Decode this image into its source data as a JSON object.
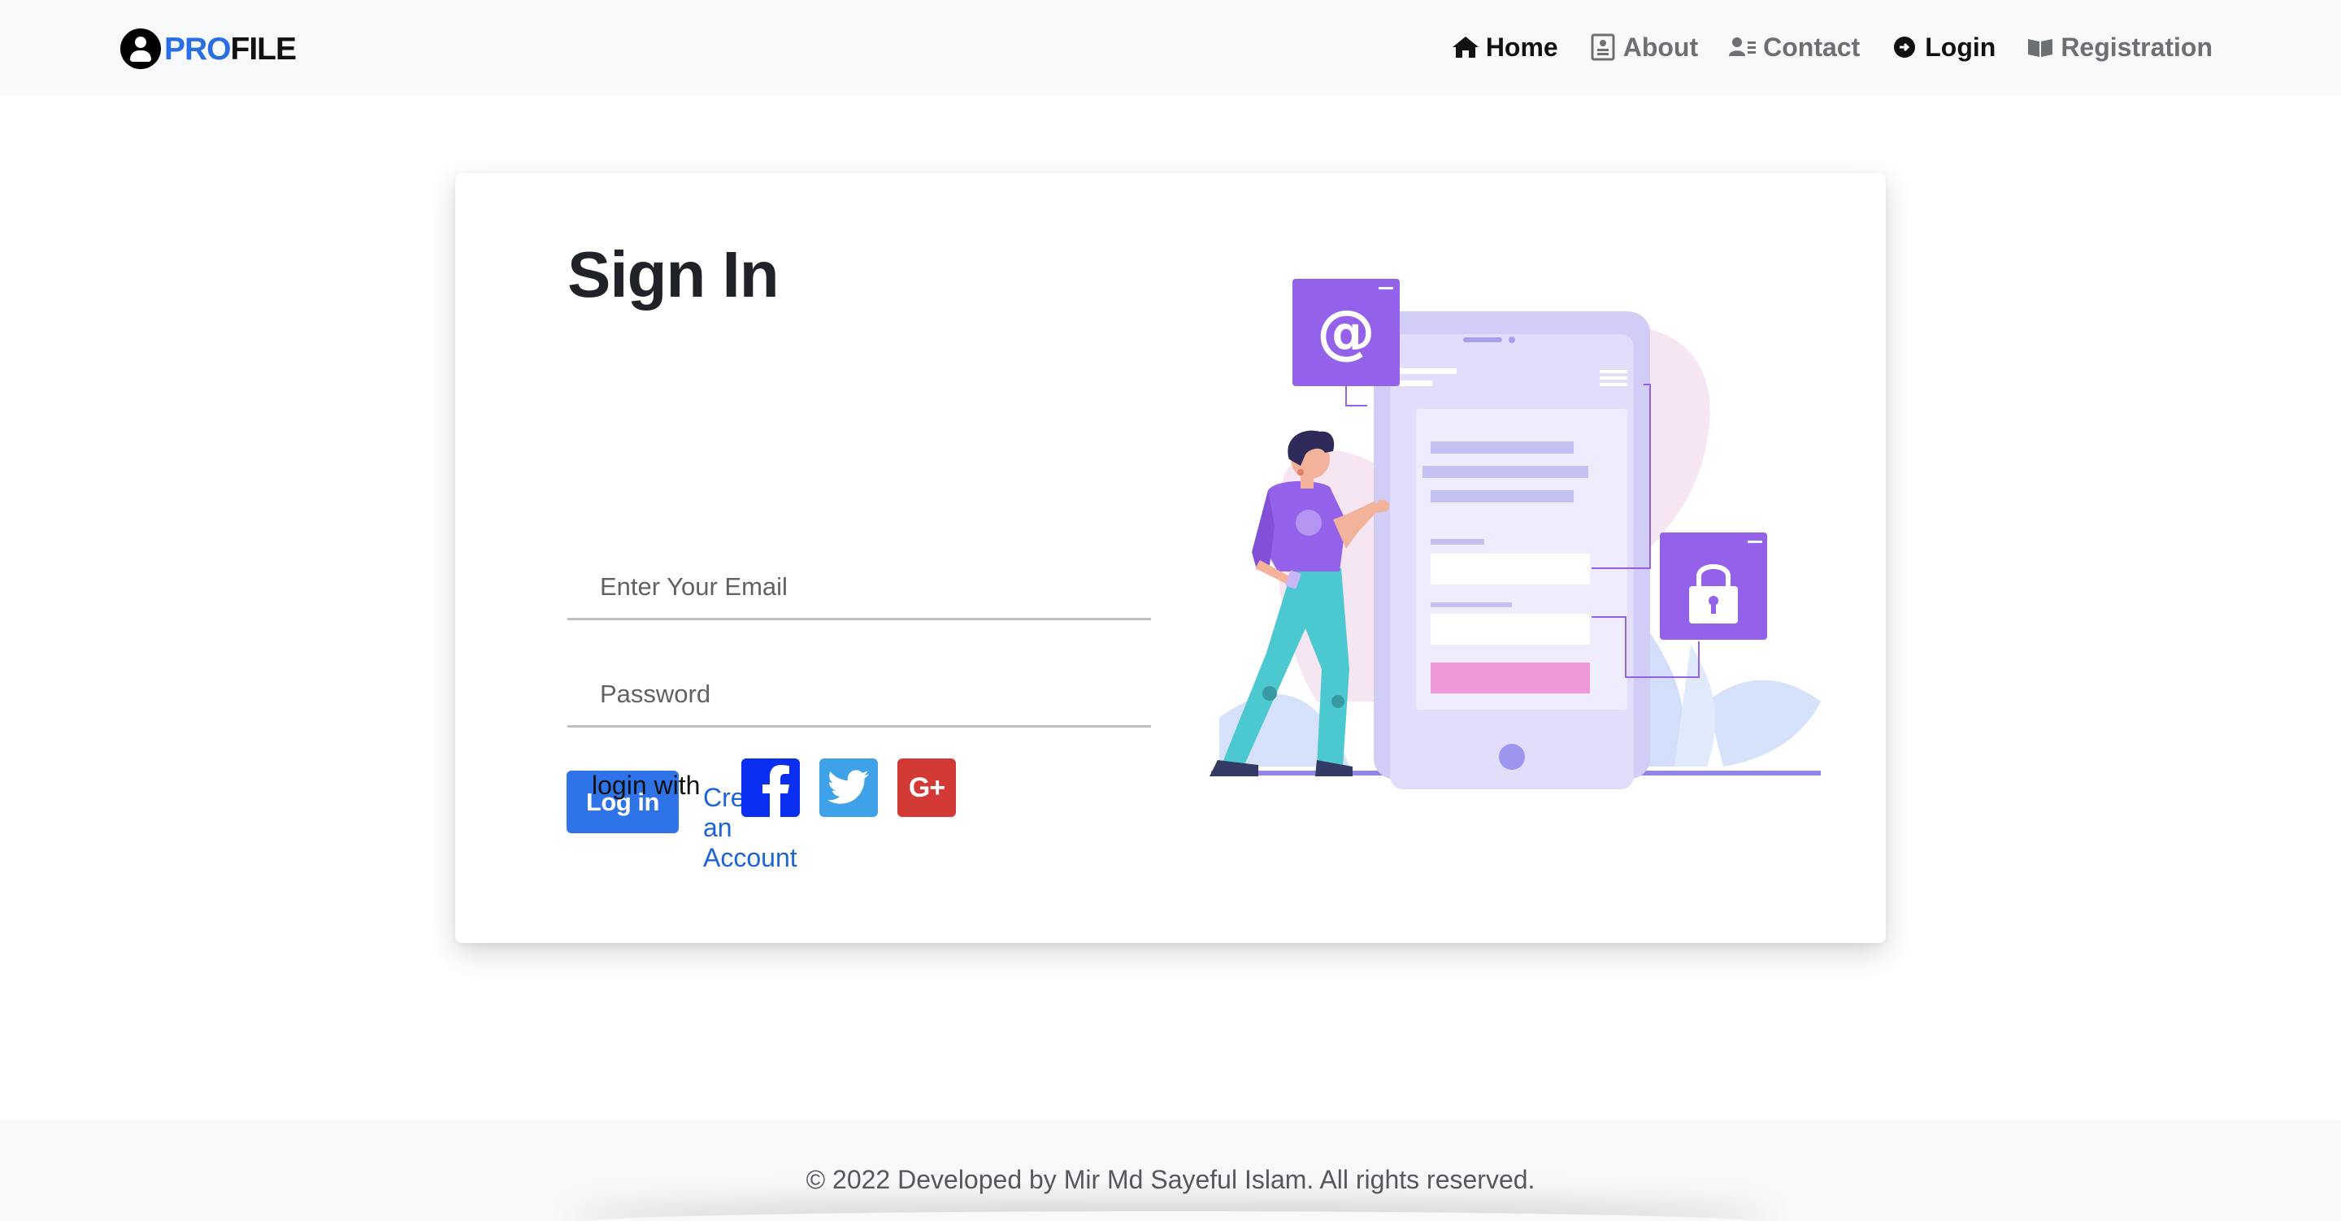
{
  "brand": {
    "pro": "PRO",
    "file": "FILE",
    "icon": "user-circle-icon"
  },
  "nav": {
    "home": "Home",
    "about": "About",
    "contact": "Contact",
    "login": "Login",
    "registration": "Registration"
  },
  "signin": {
    "title": "Sign In",
    "email_placeholder": "Enter Your Email",
    "password_placeholder": "Password",
    "login_button": "Log in",
    "create_account": "Create an Account",
    "login_with": "login with"
  },
  "social": {
    "facebook_icon": "facebook-icon",
    "twitter_icon": "twitter-icon",
    "google_plus_icon": "google-plus-icon",
    "google_plus_text": "G+"
  },
  "footer": {
    "text": "© 2022 Developed by Mir Md Sayeful Islam. All rights reserved."
  },
  "colors": {
    "accent": "#2f73e8",
    "brand_blue": "#2a6ee6",
    "facebook": "#0a2ff0",
    "twitter": "#3fa1e8",
    "google": "#d33a35",
    "illustration_purple": "#9461ea"
  }
}
